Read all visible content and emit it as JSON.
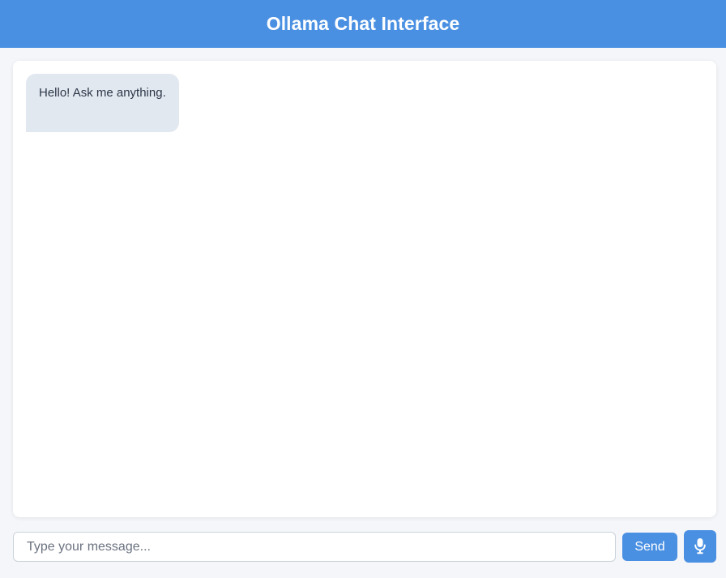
{
  "header": {
    "title": "Ollama Chat Interface"
  },
  "chat": {
    "messages": [
      {
        "role": "assistant",
        "text": "Hello! Ask me anything."
      }
    ]
  },
  "input": {
    "placeholder": "Type your message...",
    "value": ""
  },
  "controls": {
    "send_label": "Send",
    "mic_icon": "microphone-icon"
  },
  "colors": {
    "accent": "#4a90e2",
    "bubble": "#e2e8f0",
    "background": "#f4f6f9"
  }
}
